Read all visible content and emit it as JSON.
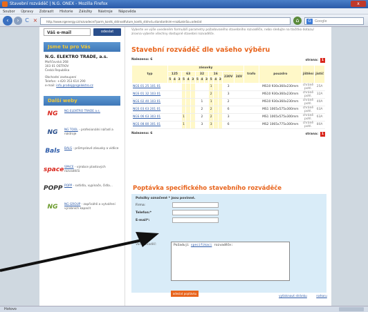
{
  "window": {
    "title": "Stavební rozváděč | N.G. ONEX - Mozilla Firefox",
    "close_label": "x"
  },
  "menu": [
    "Soubor",
    "Úpravy",
    "Zobrazit",
    "Historie",
    "Záložky",
    "Nástroje",
    "Nápověda"
  ],
  "nav": {
    "back": "‹",
    "forward": "›",
    "reload": "C",
    "stop": "×",
    "home": "⌂"
  },
  "urlbar": {
    "value": "http://www.ngenergy.cz/rozvadece/?parm_kontk_stdrvodfuture_kontk_stdrvd=standardnim+roz&aknSo=odeslat"
  },
  "search": {
    "engine_icon": "G",
    "placeholder": "Google"
  },
  "sidebar": {
    "search_value": "Váš e-mail",
    "search_button": "odeslat",
    "about_heading": "Jsme tu pro Vás",
    "company": "N.G. ELEKTRO TRADE, a.s.",
    "address": [
      "Mořičovská 268",
      "303 01 OSTROV",
      "Česká Republika"
    ],
    "contact": [
      "Obchodní zastoupení",
      "Telefon: +420 353 614 290"
    ],
    "email_label": "e-mail:",
    "email": "info.prodej@ngelektro.cz",
    "other_heading": "Další weby",
    "webs": [
      {
        "logo": "NG",
        "logo_color": "#d9261c",
        "link": "NG ELEKTRO TRADE a.s.",
        "desc": ""
      },
      {
        "logo": "NG",
        "logo_color": "#2a4f8c",
        "link": "NG TOOL",
        "desc": " - profesionální nářadí a nástroje"
      },
      {
        "logo": "Bals",
        "logo_color": "#2c5aa8",
        "link": "BALS",
        "desc": " - průmyslové zásuvky a vidlice"
      },
      {
        "logo": "space",
        "logo_color": "#d9261c",
        "link": "SPACE",
        "desc": " - výrobce plastových rozvaděčů"
      },
      {
        "logo": "POPP",
        "logo_color": "#333333",
        "link": "POPP",
        "desc": " - svítidla, vypínače, čidla..."
      },
      {
        "logo": "NG",
        "logo_color": "#6a9a2a",
        "link": "NG GROUP",
        "desc": " - zapřisáhlí a vytváření výrobních kapacit"
      }
    ]
  },
  "main": {
    "intro": "Vyberte ve výše uvedeném formuláři parametry požadovaného stavebního rozvaděče, nebo sledujte na tlačítko dotazu/ zrovna vyberte všechny dostupné stavební rozvaděče.",
    "title": "Stavební rozváděč dle vašeho výběru",
    "found_label": "Nalezeno: 6",
    "page_label": "strana:",
    "page_number": "1",
    "table": {
      "h_typ": "typ",
      "h_zasuvky": "zásuvky",
      "h_trafo": "trafo",
      "h_pouzdro": "pouzdro",
      "h_jisteni": "jištění",
      "h_jistic": "jistič",
      "h_sub": [
        "125",
        "63",
        "32",
        "16",
        "230V",
        "24V"
      ],
      "h_sub2": [
        "5",
        "4",
        "3",
        "5",
        "4",
        "3",
        "5",
        "4",
        "3",
        "5",
        "4",
        "3",
        "5",
        "4",
        "3"
      ],
      "rows": [
        {
          "typ": "NGS 01 25 101 01",
          "c": [
            "",
            "",
            "",
            "",
            "",
            "",
            "",
            "",
            "",
            "1",
            "",
            "",
            "3",
            ""
          ],
          "pouzdro": "MS10 930x360x230mm",
          "jisteni": "chráně pohl.",
          "jistic": "25A"
        },
        {
          "typ": "NGS 01 32 103 01",
          "c": [
            "",
            "",
            "",
            "",
            "",
            "",
            "",
            "",
            "",
            "2",
            "",
            "",
            "3",
            ""
          ],
          "pouzdro": "MS10 930x360x230mm",
          "jisteni": "chráně pohl.",
          "jistic": "32A"
        },
        {
          "typ": "NGS 02 40 103 01",
          "c": [
            "",
            "",
            "",
            "",
            "",
            "",
            "",
            "1",
            "",
            "1",
            "",
            "",
            "2",
            ""
          ],
          "pouzdro": "MS10 930x360x230mm",
          "jisteni": "chráně pohl.",
          "jistic": "40A"
        },
        {
          "typ": "NGS 03 63 201 01",
          "c": [
            "",
            "",
            "",
            "",
            "",
            "",
            "",
            "2",
            "",
            "2",
            "",
            "",
            "6",
            ""
          ],
          "pouzdro": "MS1 1065x575x300mm",
          "jisteni": "chráně pohl.",
          "jistic": "63A"
        },
        {
          "typ": "NGS 06 63 303 01",
          "c": [
            "",
            "",
            "",
            "1",
            "",
            "",
            "",
            "2",
            "",
            "2",
            "",
            "",
            "3",
            ""
          ],
          "pouzdro": "MS1 1065x575x300mm",
          "jisteni": "chráně pohl.",
          "jistic": "63A"
        },
        {
          "typ": "NGS 08 80 301 01",
          "c": [
            "",
            "",
            "",
            "1",
            "",
            "",
            "",
            "3",
            "",
            "3",
            "",
            "",
            "6",
            ""
          ],
          "pouzdro": "MS2 1065x775x300mm",
          "jisteni": "chráně pohl.",
          "jistic": "80A"
        }
      ]
    },
    "form": {
      "title": "Poptávka specifického stavebního rozváděče",
      "required_note": "Položky označené * jsou povinné.",
      "firma": "Firma:",
      "telefon": "Telefon:*",
      "email": "E-mail*:",
      "message_label": "Váš rozvaděč:",
      "message_text": "Požaduji ",
      "message_link": "specifikaci",
      "message_text2": " rozvaděče:",
      "submit": "odeslat poptávku"
    },
    "footer": {
      "print": "vytisknout stránku",
      "top": "nahoru"
    }
  },
  "status": {
    "text": "Hotovo"
  }
}
